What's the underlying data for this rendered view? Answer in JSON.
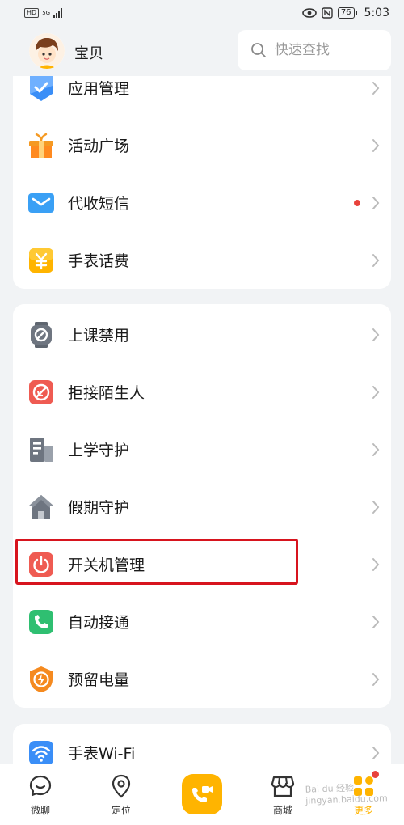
{
  "status_bar": {
    "left_badge": "HD",
    "network": "5G",
    "battery": "76",
    "time": "5:03"
  },
  "header": {
    "user_name": "宝贝",
    "search_placeholder": "快速查找"
  },
  "section1": {
    "items": [
      {
        "label": "应用管理",
        "icon": "app-management-icon"
      },
      {
        "label": "活动广场",
        "icon": "gift-icon"
      },
      {
        "label": "代收短信",
        "icon": "envelope-icon",
        "has_red_dot": true
      },
      {
        "label": "手表话费",
        "icon": "yuan-icon"
      }
    ]
  },
  "section2": {
    "items": [
      {
        "label": "上课禁用",
        "icon": "watch-ban-icon"
      },
      {
        "label": "拒接陌生人",
        "icon": "reject-stranger-icon"
      },
      {
        "label": "上学守护",
        "icon": "school-building-icon"
      },
      {
        "label": "假期守护",
        "icon": "house-icon"
      },
      {
        "label": "开关机管理",
        "icon": "power-icon",
        "highlighted": true
      },
      {
        "label": "自动接通",
        "icon": "phone-icon"
      },
      {
        "label": "预留电量",
        "icon": "battery-bolt-icon"
      }
    ]
  },
  "section3": {
    "items": [
      {
        "label": "手表Wi-Fi",
        "icon": "wifi-icon"
      }
    ]
  },
  "tabbar": {
    "tabs": [
      {
        "label": "微聊",
        "icon": "chat-icon"
      },
      {
        "label": "定位",
        "icon": "location-pin-icon"
      },
      {
        "label": "",
        "icon": "video-call-icon"
      },
      {
        "label": "商城",
        "icon": "store-icon"
      },
      {
        "label": "更多",
        "icon": "more-apps-icon"
      }
    ]
  },
  "watermark": "Bai du 经验\njingyan.baidu.com",
  "colors": {
    "background": "#f1f3f5",
    "highlight_border": "#d7141e",
    "accent": "#ffb400",
    "red_dot": "#e8423b"
  }
}
